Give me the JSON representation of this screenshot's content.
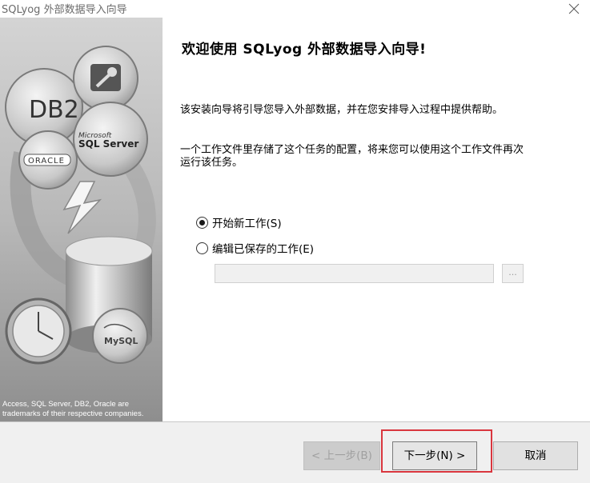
{
  "window": {
    "title": "SQLyog 外部数据导入向导"
  },
  "sidebar": {
    "logos": [
      "DB2",
      "ORACLE",
      "Microsoft",
      "SQL Server",
      "MySQL"
    ],
    "trademark_line1": "Access, SQL Server, DB2, Oracle are",
    "trademark_line2": "trademarks  of their respective companies."
  },
  "main": {
    "heading": "欢迎使用 SQLyog 外部数据导入向导!",
    "para1": "该安装向导将引导您导入外部数据，并在您安排导入过程中提供帮助。",
    "para2": "一个工作文件里存储了这个任务的配置，将来您可以使用这个工作文件再次运行该任务。",
    "options": [
      {
        "label": "开始新工作(S)",
        "checked": true
      },
      {
        "label": "编辑已保存的工作(E)",
        "checked": false
      }
    ],
    "file_path_value": "",
    "browse_label": "..."
  },
  "footer": {
    "back_label": "< 上一步(B)",
    "next_label": "下一步(N) >",
    "cancel_label": "取消"
  },
  "colors": {
    "highlight": "#d9363e",
    "sidebar_bg": "#d6d6d6"
  }
}
